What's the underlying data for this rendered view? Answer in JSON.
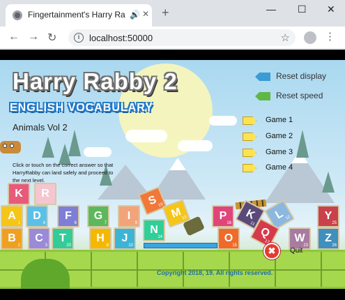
{
  "browser": {
    "tab_title": "Fingertainment's Harry Rabby 2",
    "tab_audio_icon": "speaker-icon",
    "tab_close_glyph": "✕",
    "new_tab_glyph": "+",
    "window_controls": {
      "minimize": "—",
      "maximize": "☐",
      "close": "✕"
    },
    "url": "localhost:50000",
    "nav": {
      "back": "←",
      "forward": "→",
      "reload": "↻"
    },
    "star_glyph": "☆",
    "menu_glyph": "⋮",
    "info_glyph": "i"
  },
  "game": {
    "title": "Harry Rabby 2",
    "subtitle": "ENGLISH VOCABULARY",
    "level": "Animals Vol 2",
    "instructions": "Click or touch on the correct answer so that HarryRabby can land safely and proceed to the next level.",
    "controls": {
      "reset_display": "Reset display",
      "reset_speed": "Reset speed"
    },
    "control_colors": {
      "reset_display": "#3a9bd6",
      "reset_speed": "#5fb846"
    },
    "menu": [
      "Game 1",
      "Game 2",
      "Game 3",
      "Game 4"
    ],
    "tiles": [
      {
        "letter": "K",
        "num": "",
        "color": "#e85a7a"
      },
      {
        "letter": "R",
        "num": "",
        "color": "#f4c6cf"
      },
      {
        "letter": "A",
        "num": "1",
        "color": "#f5c518"
      },
      {
        "letter": "D",
        "num": "4",
        "color": "#5bc0e8"
      },
      {
        "letter": "F",
        "num": "6",
        "color": "#7e7ed6"
      },
      {
        "letter": "G",
        "num": "7",
        "color": "#5cb85c"
      },
      {
        "letter": "I",
        "num": "9",
        "color": "#f3a37a"
      },
      {
        "letter": "P",
        "num": "16",
        "color": "#e0457a"
      },
      {
        "letter": "Y",
        "num": "25",
        "color": "#c9414a"
      },
      {
        "letter": "B",
        "num": "2",
        "color": "#f0a020"
      },
      {
        "letter": "C",
        "num": "3",
        "color": "#9a8ad8"
      },
      {
        "letter": "T",
        "num": "20",
        "color": "#33cc99"
      },
      {
        "letter": "H",
        "num": "8",
        "color": "#f5b800"
      },
      {
        "letter": "J",
        "num": "10",
        "color": "#3cb4d6"
      },
      {
        "letter": "O",
        "num": "15",
        "color": "#f06a2a"
      },
      {
        "letter": "W",
        "num": "23",
        "color": "#a87ba0"
      },
      {
        "letter": "Z",
        "num": "26",
        "color": "#3f8fbf"
      },
      {
        "letter": "S",
        "num": "19",
        "color": "#f0793a"
      },
      {
        "letter": "N",
        "num": "14",
        "color": "#2fcf9a"
      },
      {
        "letter": "M",
        "num": "13",
        "color": "#f5c518"
      },
      {
        "letter": "K",
        "num": "11",
        "color": "#5a4a7a"
      },
      {
        "letter": "L",
        "num": "12",
        "color": "#8cb8e0"
      },
      {
        "letter": "Q",
        "num": "17",
        "color": "#d63a4a"
      }
    ],
    "quit_label": "Quit",
    "quit_glyph": "✖",
    "copyright": "Copyright 2018, 19. All rights reserved."
  }
}
